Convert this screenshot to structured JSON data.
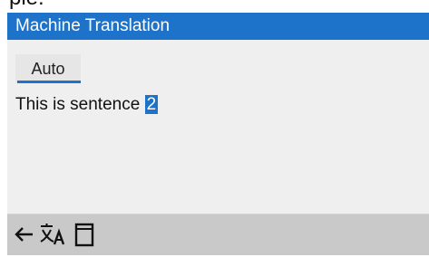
{
  "caption": {
    "text": "ple:"
  },
  "window": {
    "title": "Machine Translation"
  },
  "tabs": [
    {
      "label": "Auto",
      "selected": true
    }
  ],
  "content": {
    "sentence_prefix": "This is sentence ",
    "sentence_highlight": "2"
  },
  "toolbar": {
    "icons": [
      "back-arrow-icon",
      "translate-icon",
      "copy-icon"
    ]
  },
  "colors": {
    "accent": "#1d73c9",
    "panel_bg": "#efefef",
    "toolbar_bg": "#c9c9c9",
    "tab_bg": "#e6e6e6"
  }
}
